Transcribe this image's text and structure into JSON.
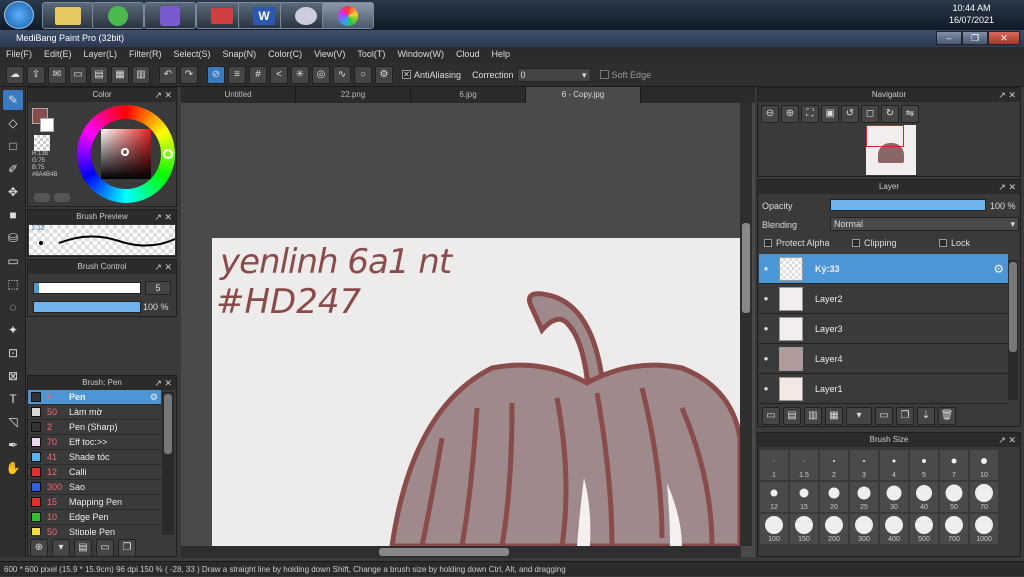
{
  "taskbar": {
    "time": "10:44 AM",
    "date": "16/07/2021"
  },
  "app": {
    "title": "MediBang Paint Pro (32bit)"
  },
  "menu": [
    "File(F)",
    "Edit(E)",
    "Layer(L)",
    "Filter(R)",
    "Select(S)",
    "Snap(N)",
    "Color(C)",
    "View(V)",
    "Tool(T)",
    "Window(W)",
    "Cloud",
    "Help"
  ],
  "toolbar": {
    "antialias": "AntiAliasing",
    "correction_label": "Correction",
    "correction_value": "0",
    "soft_edge": "Soft Edge"
  },
  "tabs": [
    "Untitled",
    "22.png",
    "6.jpg",
    "6 - Copy.jpg"
  ],
  "color_panel": {
    "title": "Color",
    "r": "R:138",
    "g": "G:75",
    "b": "B:75",
    "hex": "#8A4B4B",
    "main_color": "#8a4b4b"
  },
  "brush_preview": {
    "title": "Brush Preview",
    "size": "1.32"
  },
  "brush_control": {
    "title": "Brush Control",
    "size": "5",
    "opacity": "100 %"
  },
  "brush_list": {
    "title": "Brush: Pen",
    "items": [
      {
        "size": "5",
        "name": "Pen",
        "color": "#333333",
        "selected": true
      },
      {
        "size": "50",
        "name": "Làm mờ",
        "color": "#d8d8d8"
      },
      {
        "size": "2",
        "name": "Pen (Sharp)",
        "color": "#333333"
      },
      {
        "size": "70",
        "name": "Eff toc:>>",
        "color": "#f0d8f0"
      },
      {
        "size": "41",
        "name": "Shade tóc",
        "color": "#5ab4f0"
      },
      {
        "size": "12",
        "name": "Calli",
        "color": "#e03030"
      },
      {
        "size": "300",
        "name": "Sao",
        "color": "#3060e0"
      },
      {
        "size": "15",
        "name": "Mapping Pen",
        "color": "#e03030"
      },
      {
        "size": "10",
        "name": "Edge Pen",
        "color": "#30c030"
      },
      {
        "size": "50",
        "name": "Stipple Pen",
        "color": "#f0e040"
      }
    ]
  },
  "canvas": {
    "text_line1": "yenlinh 6a1 nt",
    "text_line2": "#HD247"
  },
  "navigator": {
    "title": "Navigator"
  },
  "layer_panel": {
    "title": "Layer",
    "opacity_label": "Opacity",
    "opacity_value": "100 %",
    "blending_label": "Blending",
    "blending_value": "Normal",
    "protect_alpha": "Protect Alpha",
    "clipping": "Clipping",
    "lock": "Lock",
    "layers": [
      {
        "name": "Ký:33",
        "selected": true
      },
      {
        "name": "Layer2"
      },
      {
        "name": "Layer3"
      },
      {
        "name": "Layer4"
      },
      {
        "name": "Layer1"
      }
    ]
  },
  "brush_size": {
    "title": "Brush Size",
    "sizes": [
      "1",
      "1.5",
      "2",
      "3",
      "4",
      "5",
      "7",
      "10",
      "12",
      "15",
      "20",
      "25",
      "30",
      "40",
      "50",
      "70",
      "100",
      "150",
      "200",
      "300",
      "400",
      "500",
      "700",
      "1000"
    ]
  },
  "status": {
    "text": "600 * 600 pixel   (15.9 * 15.9cm)   96 dpi   150 %   ( -28, 33 )   Draw a straight line by holding down Shift, Change a brush size by holding down Ctrl, Alt, and dragging"
  }
}
